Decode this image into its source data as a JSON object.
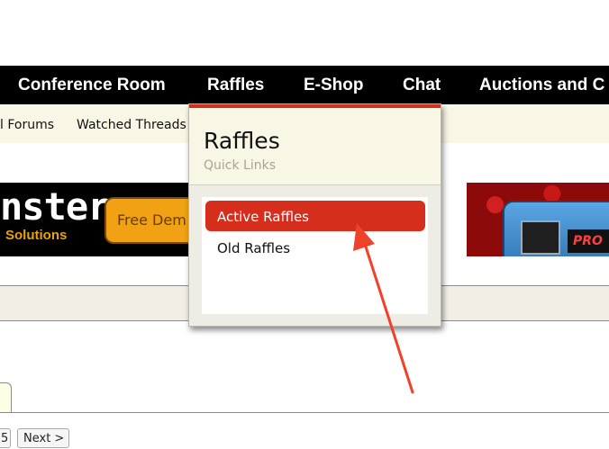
{
  "nav": {
    "items": [
      "Conference Room",
      "Raffles",
      "E-Shop",
      "Chat",
      "Auctions and C"
    ]
  },
  "subnav": {
    "items": [
      "l Forums",
      "Watched Threads"
    ]
  },
  "banner": {
    "word": "nster",
    "tagline": "Solutions",
    "cta": "Free Dem",
    "device_label": "PRO"
  },
  "dropdown": {
    "title": "Raffles",
    "subtitle": "Quick Links",
    "items": [
      {
        "label": "Active Raffles",
        "active": true
      },
      {
        "label": "Old Raffles",
        "active": false
      }
    ]
  },
  "pagination": {
    "page_fragment": "5",
    "next_label": "Next >"
  },
  "colors": {
    "accent": "#d52e1d",
    "navbar": "#000000",
    "subnav_bg": "#f8f7e5",
    "annotation_arrow": "#f0412a"
  }
}
